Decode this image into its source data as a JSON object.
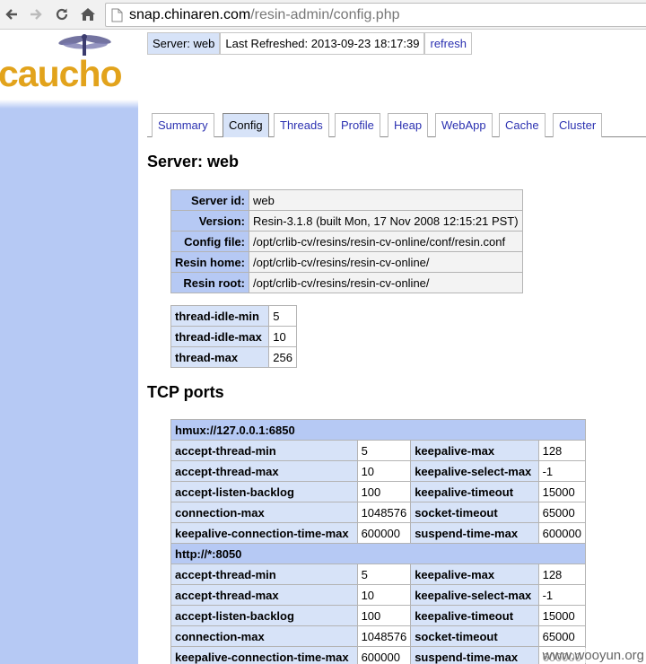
{
  "browser": {
    "url_host": "snap.chinaren.com",
    "url_path": "/resin-admin/config.php"
  },
  "logo": {
    "text": "caucho"
  },
  "status": {
    "server": "Server: web",
    "last_refreshed": "Last Refreshed: 2013-09-23 18:17:39",
    "refresh_label": "refresh"
  },
  "tabs": [
    {
      "label": "Summary"
    },
    {
      "label": "Config"
    },
    {
      "label": "Threads"
    },
    {
      "label": "Profile"
    },
    {
      "label": "Heap"
    },
    {
      "label": "WebApp"
    },
    {
      "label": "Cache"
    },
    {
      "label": "Cluster"
    }
  ],
  "active_tab": "Config",
  "server_heading": "Server: web",
  "server_info": [
    {
      "label": "Server id:",
      "value": "web"
    },
    {
      "label": "Version:",
      "value": "Resin-3.1.8 (built Mon, 17 Nov 2008 12:15:21 PST)"
    },
    {
      "label": "Config file:",
      "value": "/opt/crlib-cv/resins/resin-cv-online/conf/resin.conf"
    },
    {
      "label": "Resin home:",
      "value": "/opt/crlib-cv/resins/resin-cv-online/"
    },
    {
      "label": "Resin root:",
      "value": "/opt/crlib-cv/resins/resin-cv-online/"
    }
  ],
  "threads": [
    {
      "label": "thread-idle-min",
      "value": "5"
    },
    {
      "label": "thread-idle-max",
      "value": "10"
    },
    {
      "label": "thread-max",
      "value": "256"
    }
  ],
  "tcp_heading": "TCP ports",
  "ports": [
    {
      "name": "hmux://127.0.0.1:6850",
      "rows": [
        [
          "accept-thread-min",
          "5",
          "keepalive-max",
          "128"
        ],
        [
          "accept-thread-max",
          "10",
          "keepalive-select-max",
          "-1"
        ],
        [
          "accept-listen-backlog",
          "100",
          "keepalive-timeout",
          "15000"
        ],
        [
          "connection-max",
          "1048576",
          "socket-timeout",
          "65000"
        ],
        [
          "keepalive-connection-time-max",
          "600000",
          "suspend-time-max",
          "600000"
        ]
      ]
    },
    {
      "name": "http://*:8050",
      "rows": [
        [
          "accept-thread-min",
          "5",
          "keepalive-max",
          "128"
        ],
        [
          "accept-thread-max",
          "10",
          "keepalive-select-max",
          "-1"
        ],
        [
          "accept-listen-backlog",
          "100",
          "keepalive-timeout",
          "15000"
        ],
        [
          "connection-max",
          "1048576",
          "socket-timeout",
          "65000"
        ],
        [
          "keepalive-connection-time-max",
          "600000",
          "suspend-time-max",
          "600000"
        ]
      ]
    }
  ],
  "watermark": "www.wooyun.org",
  "colors": {
    "header_blue": "#b6c9f4",
    "label_blue": "#d7e3f8",
    "link": "#2b31b1",
    "logo_orange": "#e2a31c"
  }
}
